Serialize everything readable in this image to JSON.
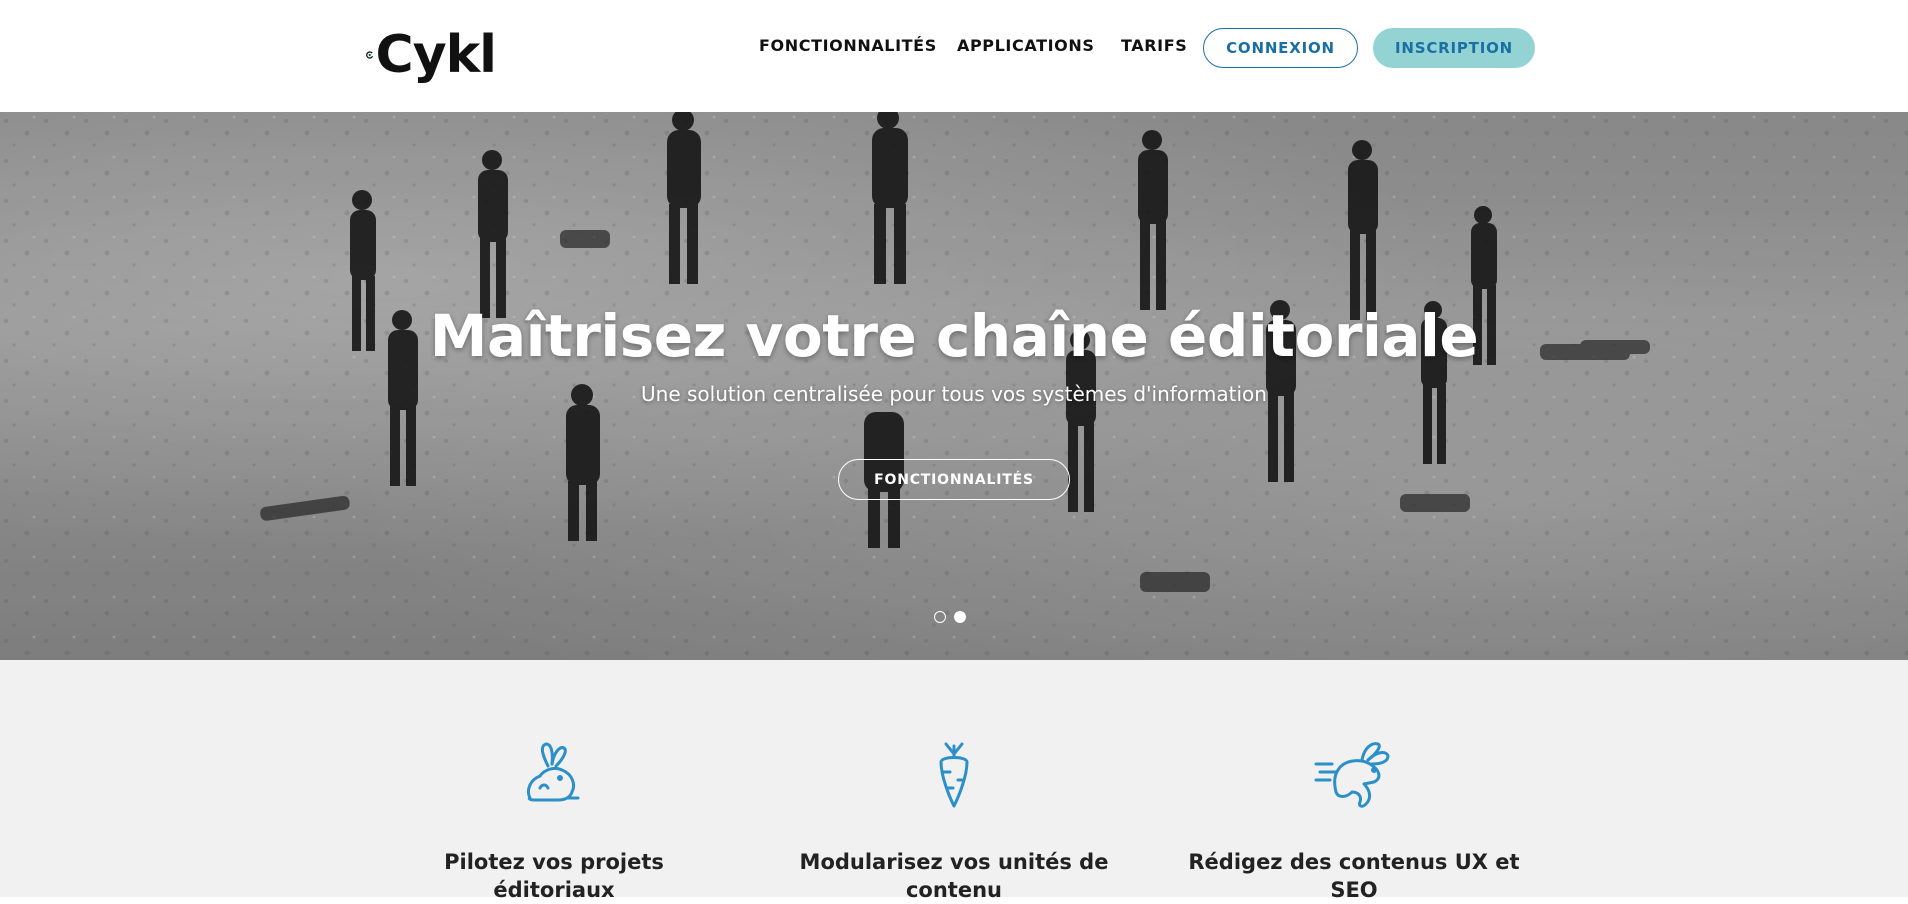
{
  "header": {
    "logo_text": "Cykl",
    "nav": {
      "features": "FONCTIONNALITÉS",
      "applications": "APPLICATIONS",
      "pricing": "TARIFS"
    },
    "login_label": "CONNEXION",
    "signup_label": "INSCRIPTION"
  },
  "hero": {
    "title": "Maîtrisez votre chaîne éditoriale",
    "subtitle": "Une solution centralisée pour tous vos systèmes d'information",
    "cta_label": "FONCTIONNALITÉS",
    "carousel": {
      "slides": 2,
      "active_slide": 2
    }
  },
  "features": [
    {
      "icon": "rabbit-icon",
      "title": "Pilotez vos projets éditoriaux"
    },
    {
      "icon": "carrot-icon",
      "title": "Modularisez vos unités de contenu"
    },
    {
      "icon": "running-rabbit-icon",
      "title": "Rédigez des contenus UX et SEO"
    }
  ],
  "colors": {
    "accent_blue": "#1a6fa3",
    "signup_bg": "#93d3d3",
    "icon_blue": "#2b8fc9",
    "features_bg": "#f1f1f1"
  }
}
